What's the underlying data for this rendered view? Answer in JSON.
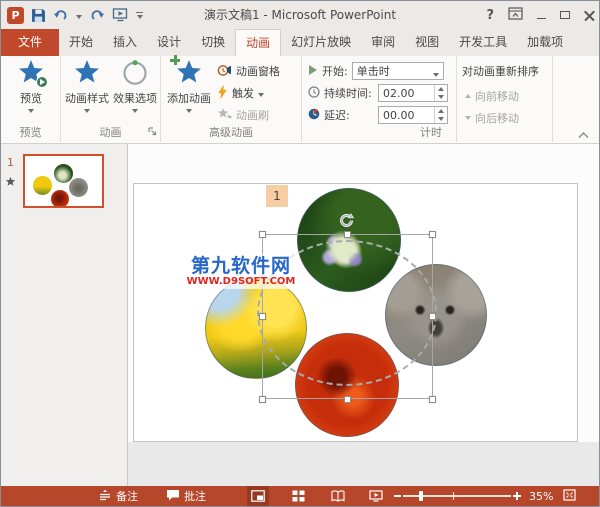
{
  "titlebar": {
    "title": "演示文稿1 - Microsoft PowerPoint",
    "logo_letter": "P",
    "help_glyph": "?"
  },
  "tabs": [
    {
      "label": "文件"
    },
    {
      "label": "开始"
    },
    {
      "label": "插入"
    },
    {
      "label": "设计"
    },
    {
      "label": "切换"
    },
    {
      "label": "动画"
    },
    {
      "label": "幻灯片放映"
    },
    {
      "label": "审阅"
    },
    {
      "label": "视图"
    },
    {
      "label": "开发工具"
    },
    {
      "label": "加载项"
    }
  ],
  "ribbon": {
    "preview": {
      "button": "预览",
      "group": "预览"
    },
    "animation": {
      "style_button": "动画样式",
      "effect_button": "效果选项",
      "group": "动画"
    },
    "advanced": {
      "add_button": "添加动画",
      "pane_button": "动画窗格",
      "trigger_button": "触发",
      "painter_button": "动画刷",
      "group": "高级动画"
    },
    "timing": {
      "start_label": "开始:",
      "start_value": "单击时",
      "duration_label": "持续时间:",
      "duration_value": "02.00",
      "delay_label": "延迟:",
      "delay_value": "00.00",
      "group": "计时"
    },
    "reorder": {
      "title": "对动画重新排序",
      "move_earlier": "向前移动",
      "move_later": "向后移动"
    }
  },
  "slides_panel": {
    "slide_number": "1"
  },
  "slide": {
    "animation_badge": "1",
    "watermark_line1": "第九软件网",
    "watermark_line2": "WWW.D9SOFT.COM",
    "pictures": [
      "hydrangea flower",
      "yellow tulips",
      "koala",
      "red chrysanthemum"
    ]
  },
  "statusbar": {
    "notes": "备注",
    "comments": "批注",
    "zoom_level": "35%"
  },
  "colors": {
    "accent": "#B7472A",
    "file_tab": "#C0492C",
    "star_blue": "#2E74B5",
    "selection_border": "#A6A6A6",
    "thumb_selected_border": "#D04F2C",
    "badge_bg": "#F7CDA4",
    "watermark_blue": "#2667C9",
    "watermark_red": "#E2251E"
  }
}
